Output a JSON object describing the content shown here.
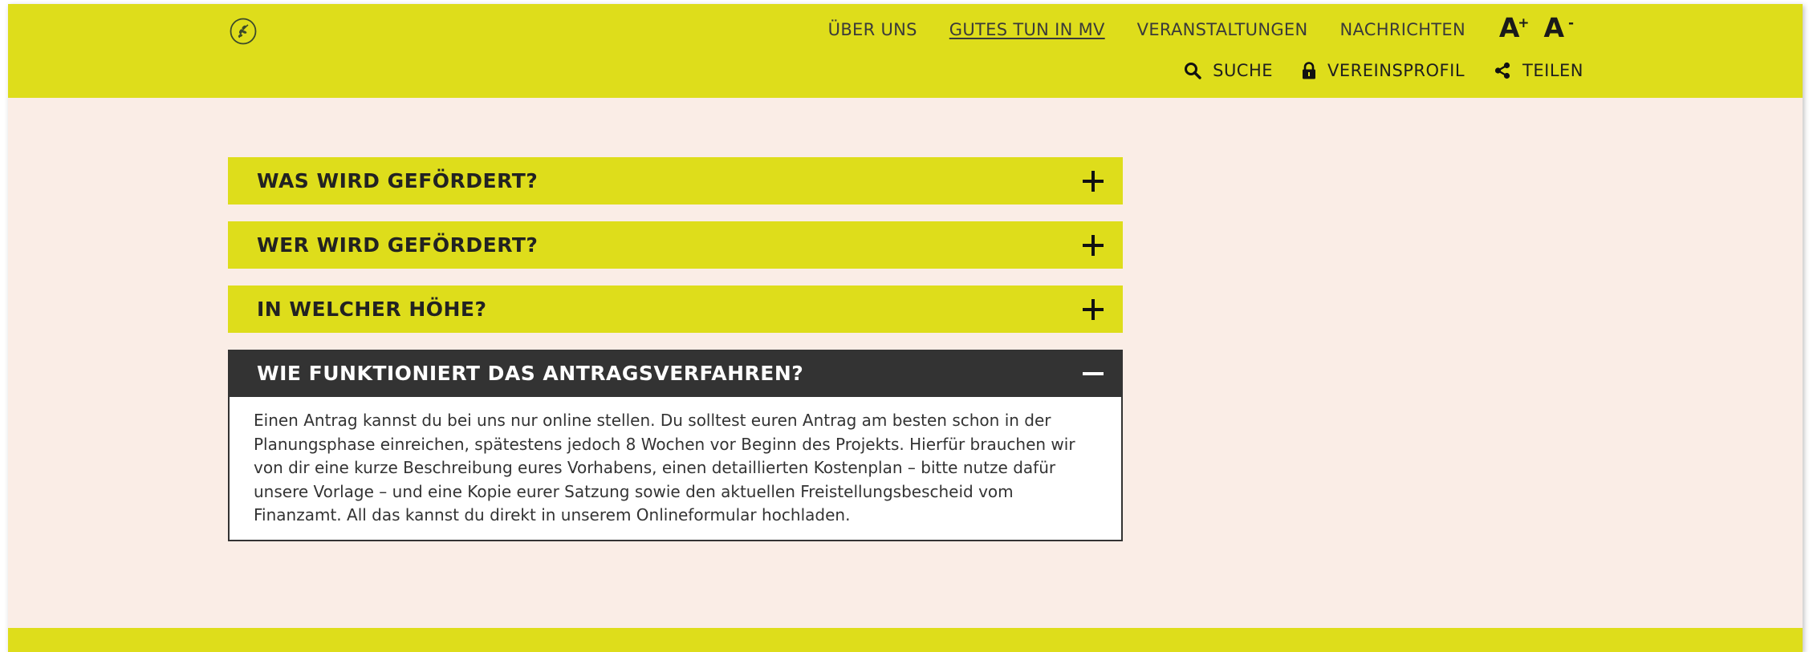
{
  "header": {
    "nav": [
      {
        "label": "ÜBER UNS",
        "active": false
      },
      {
        "label": "GUTES TUN IN MV",
        "active": true
      },
      {
        "label": "VERANSTALTUNGEN",
        "active": false
      },
      {
        "label": "NACHRICHTEN",
        "active": false
      }
    ],
    "fontsize": {
      "increase": "A",
      "increase_sign": "+",
      "decrease": "A",
      "decrease_sign": "-"
    },
    "util": {
      "search": {
        "label": "SUCHE",
        "icon": "search-icon"
      },
      "profile": {
        "label": "VEREINSPROFIL",
        "icon": "lock-icon"
      },
      "share": {
        "label": "TEILEN",
        "icon": "share-icon"
      }
    }
  },
  "accordion": [
    {
      "title": "WAS WIRD GEFÖRDERT?",
      "expanded": false
    },
    {
      "title": "WER WIRD GEFÖRDERT?",
      "expanded": false
    },
    {
      "title": "IN WELCHER HÖHE?",
      "expanded": false
    },
    {
      "title": "WIE FUNKTIONIERT DAS ANTRAGSVERFAHREN?",
      "expanded": true,
      "body": "Einen Antrag kannst du bei uns nur online stellen. Du solltest euren Antrag am besten schon in der Planungsphase einreichen, spätestens jedoch 8 Wochen vor Beginn des Projekts. Hierfür brauchen wir von dir eine kurze Beschreibung eures Vorhabens, einen detaillierten Kostenplan – bitte nutze dafür unsere Vorlage – und eine Kopie eurer Satzung sowie den aktuellen Freistellungsbescheid vom Finanzamt. All das kannst du direkt in unserem Onlineformular hochladen."
    }
  ],
  "colors": {
    "brand": "#dedd1b",
    "background": "#faede6",
    "active_header": "#333333"
  }
}
